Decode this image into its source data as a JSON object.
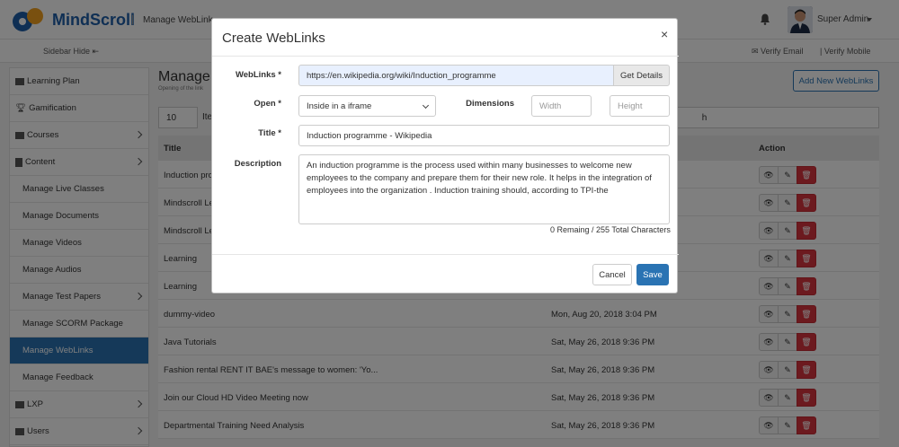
{
  "header": {
    "app_name": "MindScroll",
    "separator": "|",
    "page_label": "Manage WebLink",
    "user_name": "Super Admin"
  },
  "subbar": {
    "sidebar_hide": "Sidebar Hide",
    "verify_email": "Verify Email",
    "verify_mobile": "| Verify Mobile"
  },
  "sidebar": {
    "items": [
      {
        "label": "Learning Plan"
      },
      {
        "label": "Gamification"
      },
      {
        "label": "Courses"
      },
      {
        "label": "Content"
      },
      {
        "label": "Manage Live Classes"
      },
      {
        "label": "Manage Documents"
      },
      {
        "label": "Manage Videos"
      },
      {
        "label": "Manage Audios"
      },
      {
        "label": "Manage Test Papers"
      },
      {
        "label": "Manage SCORM Package"
      },
      {
        "label": "Manage WebLinks"
      },
      {
        "label": "Manage Feedback"
      },
      {
        "label": "LXP"
      },
      {
        "label": "Users"
      }
    ]
  },
  "main": {
    "title": "Manage",
    "subtitle": "Opening of the link",
    "add_button": "Add New WebLinks",
    "per_page": "10",
    "per_page_label": "Ite",
    "search_value": "h",
    "columns": {
      "title": "Title",
      "action": "Action"
    },
    "rows": [
      {
        "title": "Induction pro",
        "date": ""
      },
      {
        "title": "Mindscroll Le",
        "date": ""
      },
      {
        "title": "Mindscroll Le",
        "date": ""
      },
      {
        "title": "Learning",
        "date": ""
      },
      {
        "title": "Learning",
        "date": ""
      },
      {
        "title": "dummy-video",
        "date": "Mon, Aug 20, 2018 3:04 PM"
      },
      {
        "title": "Java Tutorials",
        "date": "Sat, May 26, 2018 9:36 PM"
      },
      {
        "title": "Fashion rental RENT IT BAE's message to women: 'Yo...",
        "date": "Sat, May 26, 2018 9:36 PM"
      },
      {
        "title": "Join our Cloud HD Video Meeting now",
        "date": "Sat, May 26, 2018 9:36 PM"
      },
      {
        "title": "Departmental Training Need Analysis",
        "date": "Sat, May 26, 2018 9:36 PM"
      }
    ]
  },
  "modal": {
    "title": "Create WebLinks",
    "close": "×",
    "weblinks_label": "WebLinks *",
    "weblinks_value": "https://en.wikipedia.org/wiki/Induction_programme",
    "get_details": "Get Details",
    "open_label": "Open *",
    "open_value": "Inside in a iframe",
    "dimensions_label": "Dimensions",
    "width_placeholder": "Width",
    "height_placeholder": "Height",
    "title_label": "Title *",
    "title_value": "Induction programme - Wikipedia",
    "description_label": "Description",
    "description_value": "An induction programme is the process used within many businesses to welcome new employees to the company and prepare them for their new role. It helps in the integration of employees into the organization . Induction training should, according to TPI-the",
    "counter": "0 Remaing / 255 Total Characters",
    "cancel": "Cancel",
    "save": "Save"
  },
  "colors": {
    "brand": "#1f5fa8",
    "primary": "#2a73b3",
    "danger": "#d9343e"
  }
}
